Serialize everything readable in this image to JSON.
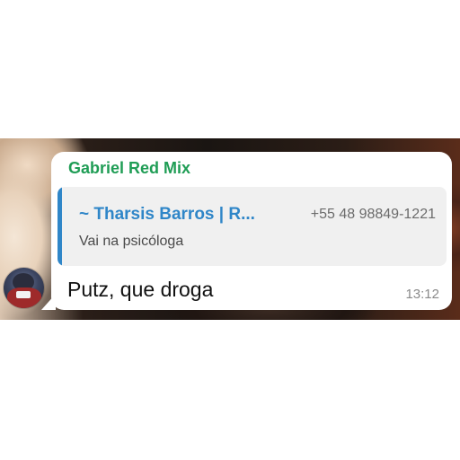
{
  "message": {
    "sender_name": "Gabriel Red Mix",
    "quoted": {
      "author": "~ Tharsis Barros | R...",
      "phone": "+55 48 98849-1221",
      "text": "Vai na psicóloga"
    },
    "text": "Putz, que droga",
    "time": "13:12"
  },
  "colors": {
    "sender_name": "#1f9d55",
    "quote_accent": "#2f86c8",
    "bubble": "#ffffff",
    "quote_background": "#f0f0f0"
  },
  "icons": {
    "avatar": "user-avatar"
  }
}
